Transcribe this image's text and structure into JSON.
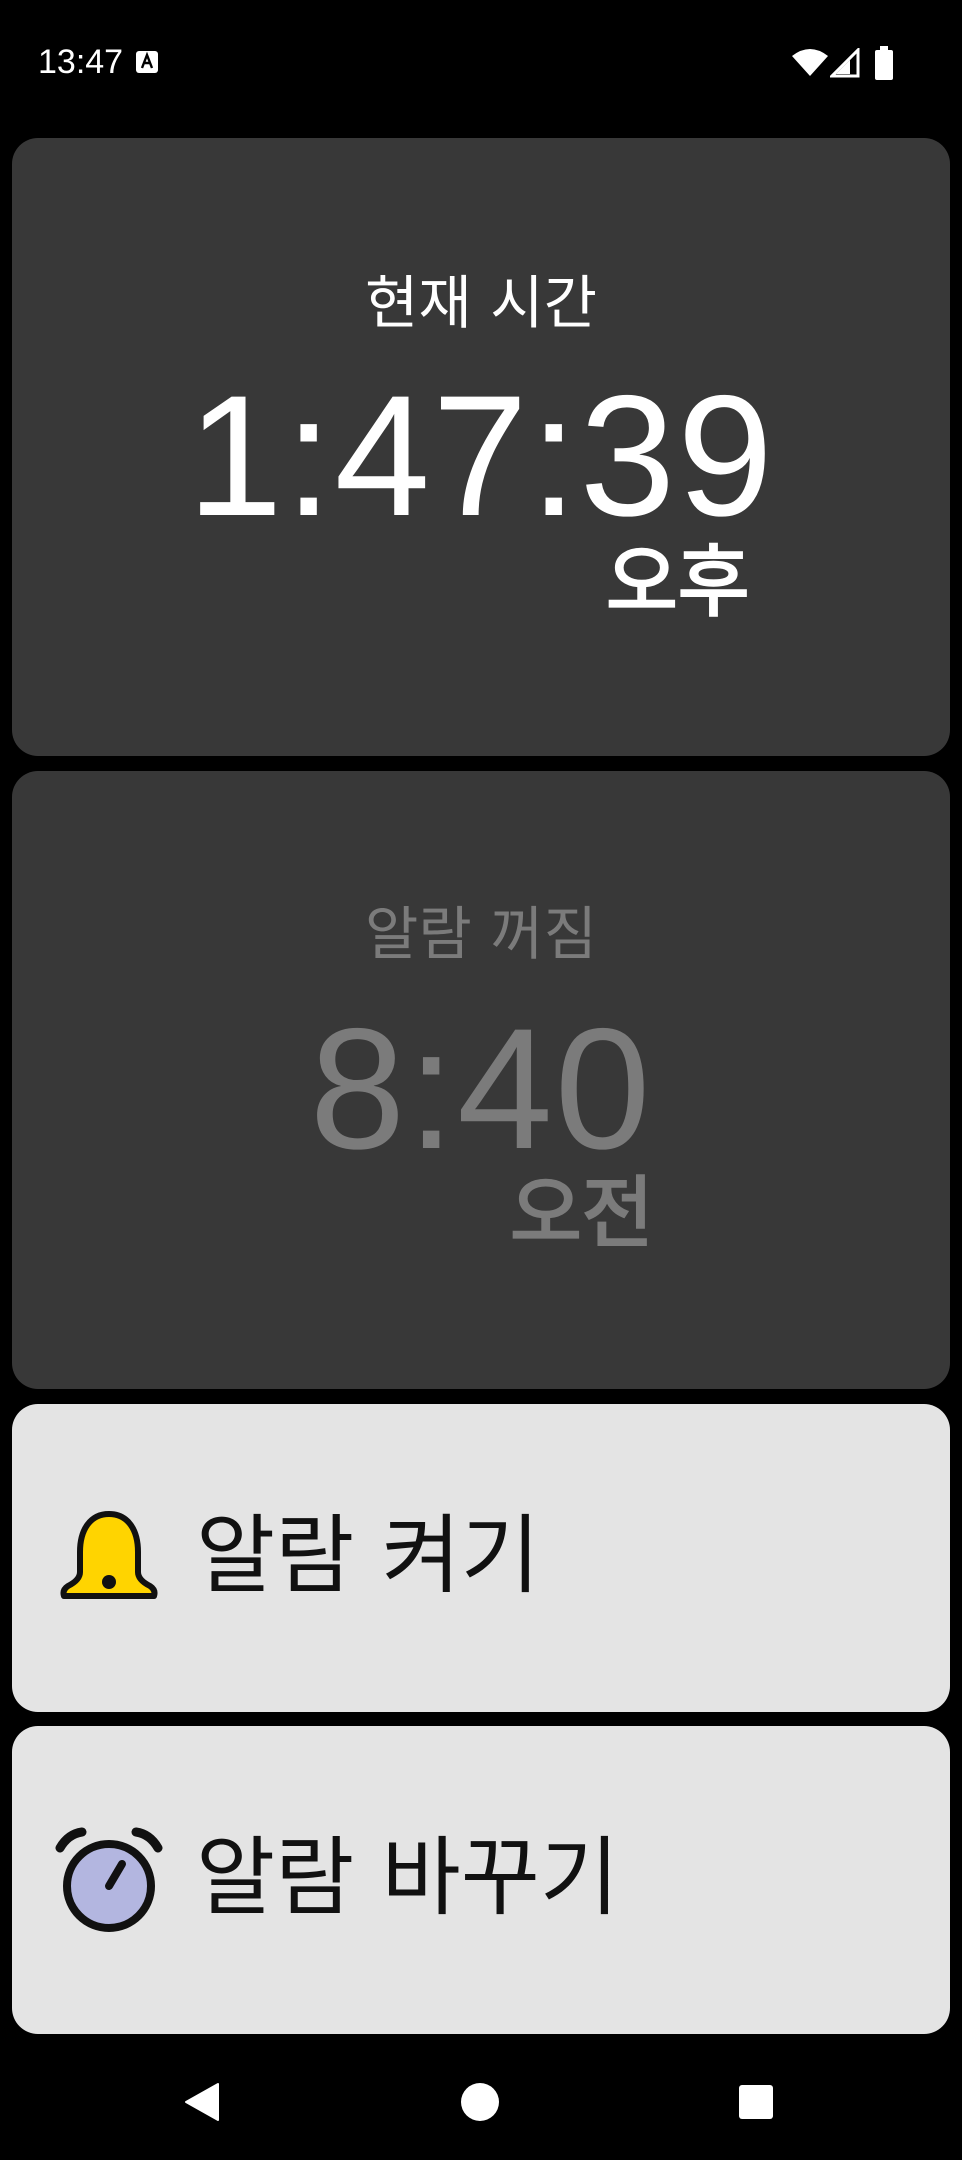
{
  "status_bar": {
    "time": "13:47",
    "icons": [
      "text-a-icon",
      "wifi-icon",
      "cell-signal-icon",
      "battery-icon"
    ]
  },
  "clock_card": {
    "label": "현재 시간",
    "time": "1:47:39",
    "ampm": "오후"
  },
  "alarm_card": {
    "label": "알람 꺼짐",
    "time": "8:40",
    "ampm": "오전"
  },
  "actions": {
    "toggle_alarm": {
      "icon": "bell-icon",
      "label": "알람 켜기"
    },
    "change_alarm": {
      "icon": "alarm-clock-icon",
      "label": "알람 바꾸기"
    }
  },
  "nav_bar": {
    "icons": [
      "back-icon",
      "home-icon",
      "recents-icon"
    ]
  },
  "colors": {
    "background": "#000000",
    "dark_card": "#383838",
    "light_card": "#e4e4e4",
    "disabled_text": "#7b7b7b",
    "bell_yellow": "#ffd400",
    "clock_face": "#b3b6e0"
  }
}
